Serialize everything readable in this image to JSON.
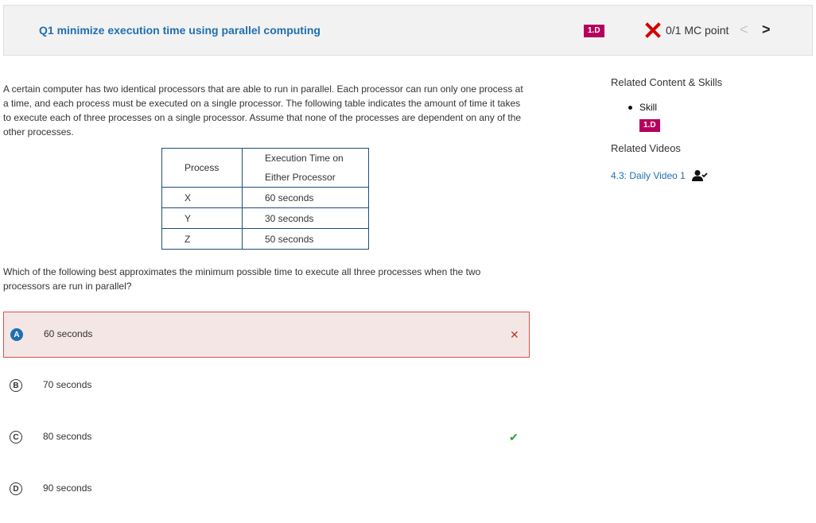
{
  "header": {
    "title": "Q1 minimize execution time using parallel computing",
    "skill_badge": "1.D",
    "score": "0/1 MC point",
    "prev": "<",
    "next": ">"
  },
  "stem": "A certain computer has two identical processors that are able to run in parallel. Each processor can run only one process at a time, and each process must be executed on a single processor. The following table indicates the amount of time it takes to execute each of three processes on a single processor. Assume that none of the processes are dependent on any of the other processes.",
  "table": {
    "headers": [
      "Process",
      "Execution Time on Either Processor"
    ],
    "rows": [
      [
        "X",
        "60 seconds"
      ],
      [
        "Y",
        "30 seconds"
      ],
      [
        "Z",
        "50 seconds"
      ]
    ]
  },
  "question": "Which of the following best approximates the minimum possible time to execute all three processes when the two processors are run in parallel?",
  "choices": [
    {
      "letter": "A",
      "text": "60 seconds",
      "mark": "✕"
    },
    {
      "letter": "B",
      "text": "70 seconds",
      "mark": ""
    },
    {
      "letter": "C",
      "text": "80 seconds",
      "mark": "✔"
    },
    {
      "letter": "D",
      "text": "90 seconds",
      "mark": ""
    }
  ],
  "sidebar": {
    "related_heading": "Related Content & Skills",
    "skill_label": "Skill",
    "skill_badge": "1.D",
    "videos_heading": "Related Videos",
    "video_link": "4.3: Daily Video 1"
  },
  "colors": {
    "link": "#1f6fb0",
    "badge": "#b5005e",
    "wrong": "#c0392b",
    "correct": "#2e9c3e",
    "selected_bg": "#f5e6e6"
  },
  "icons": {
    "score": "x-mark-icon",
    "video": "person-check-icon"
  }
}
